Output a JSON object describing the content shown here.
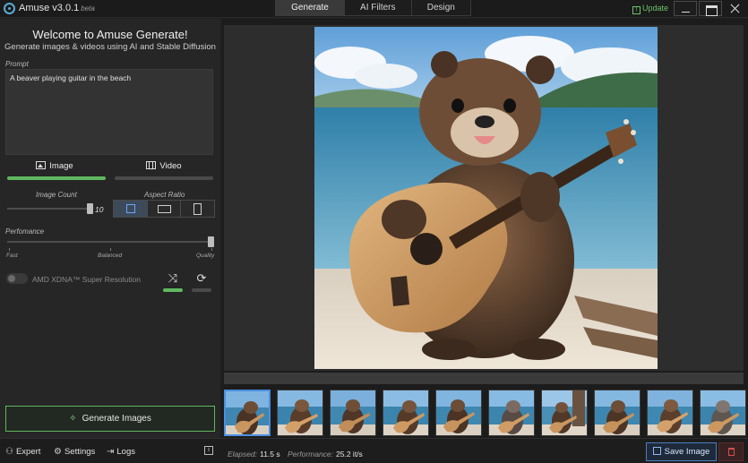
{
  "window": {
    "title": "Amuse v3.0.1",
    "beta": "beta",
    "update_label": "Update",
    "update_icon": "!"
  },
  "tabs": [
    {
      "label": "Generate",
      "active": true
    },
    {
      "label": "AI Filters",
      "active": false
    },
    {
      "label": "Design",
      "active": false
    }
  ],
  "left": {
    "welcome": "Welcome to Amuse Generate!",
    "subtitle": "Generate images & videos using AI and Stable Diffusion",
    "prompt_label": "Prompt",
    "prompt_value": "A beaver playing guitar in the beach",
    "modes": [
      {
        "label": "Image",
        "icon": "image-icon",
        "active": true
      },
      {
        "label": "Video",
        "icon": "video-icon",
        "active": false
      }
    ],
    "image_count_label": "Image Count",
    "image_count_value": "10",
    "aspect_ratio_label": "Aspect Ratio",
    "aspect_ratios": [
      "square",
      "landscape",
      "portrait"
    ],
    "aspect_selected": "square",
    "performance_label": "Perfomance",
    "performance_levels": [
      "Fast",
      "Balanced",
      "Quality"
    ],
    "performance_selected": "Quality",
    "xdna_label": "AMD XDNA™ Super Resolution",
    "xdna_enabled": false,
    "shuffle_icon": "⤨",
    "refresh_icon": "⟳",
    "generate_label": "Generate Images"
  },
  "bottom": {
    "expert_label": "Expert",
    "settings_label": "Settings",
    "logs_label": "Logs",
    "info_icon": "i",
    "elapsed_label": "Elapsed:",
    "elapsed_value": "11.5 s",
    "performance_label": "Performance:",
    "performance_value": "25.2 it/s",
    "save_label": "Save Image"
  },
  "colors": {
    "accent_green": "#5fb85f",
    "accent_blue": "#4a7ec2",
    "danger": "#d05050"
  }
}
